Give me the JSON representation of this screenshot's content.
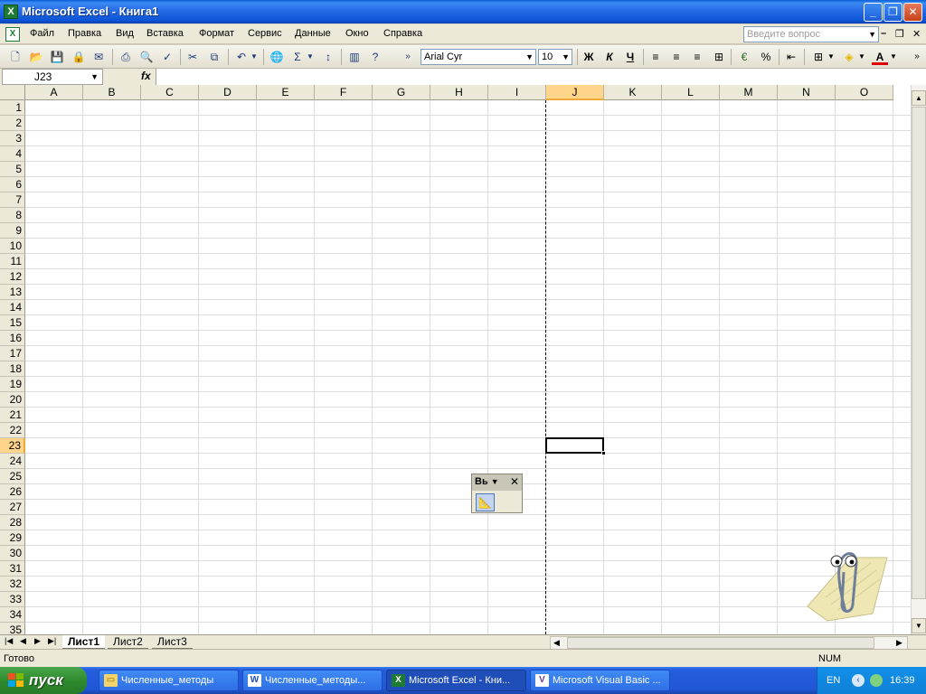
{
  "window": {
    "title": "Microsoft Excel - Книга1"
  },
  "menu": {
    "items": [
      "Файл",
      "Правка",
      "Вид",
      "Вставка",
      "Формат",
      "Сервис",
      "Данные",
      "Окно",
      "Справка"
    ],
    "help_placeholder": "Введите вопрос"
  },
  "toolbar": {
    "font_name": "Arial Cyr",
    "font_size": "10",
    "bold_label": "Ж",
    "italic_label": "К",
    "underline_label": "Ч"
  },
  "formula_bar": {
    "name_box": "J23",
    "fx_label": "fx",
    "formula": ""
  },
  "grid": {
    "columns": [
      "A",
      "B",
      "C",
      "D",
      "E",
      "F",
      "G",
      "H",
      "I",
      "J",
      "K",
      "L",
      "M",
      "N",
      "O"
    ],
    "rows": [
      "1",
      "2",
      "3",
      "4",
      "5",
      "6",
      "7",
      "8",
      "9",
      "10",
      "11",
      "12",
      "13",
      "14",
      "15",
      "16",
      "17",
      "18",
      "19",
      "20",
      "21",
      "22",
      "23",
      "24",
      "25",
      "26",
      "27",
      "28",
      "29",
      "30",
      "31",
      "32",
      "33",
      "34",
      "35"
    ],
    "active_column": "J",
    "active_row": "23"
  },
  "floating_toolbar": {
    "title": "Вь"
  },
  "sheets": {
    "tabs": [
      "Лист1",
      "Лист2",
      "Лист3"
    ],
    "active": "Лист1"
  },
  "status": {
    "ready": "Готово",
    "num": "NUM"
  },
  "taskbar": {
    "start_label": "пуск",
    "tasks": [
      {
        "label": "Численные_методы",
        "icon": "folder-icon"
      },
      {
        "label": "Численные_методы...",
        "icon": "word-icon"
      },
      {
        "label": "Microsoft Excel - Кни...",
        "icon": "excel-icon"
      },
      {
        "label": "Microsoft Visual Basic ...",
        "icon": "vba-icon"
      }
    ],
    "language": "EN",
    "clock": "16:39"
  },
  "colors": {
    "titlebar": "#0b54d4",
    "active_header": "#ffd58c",
    "start_button": "#2e8b2e",
    "taskbar": "#2157d6",
    "tray": "#0f7fd6"
  }
}
